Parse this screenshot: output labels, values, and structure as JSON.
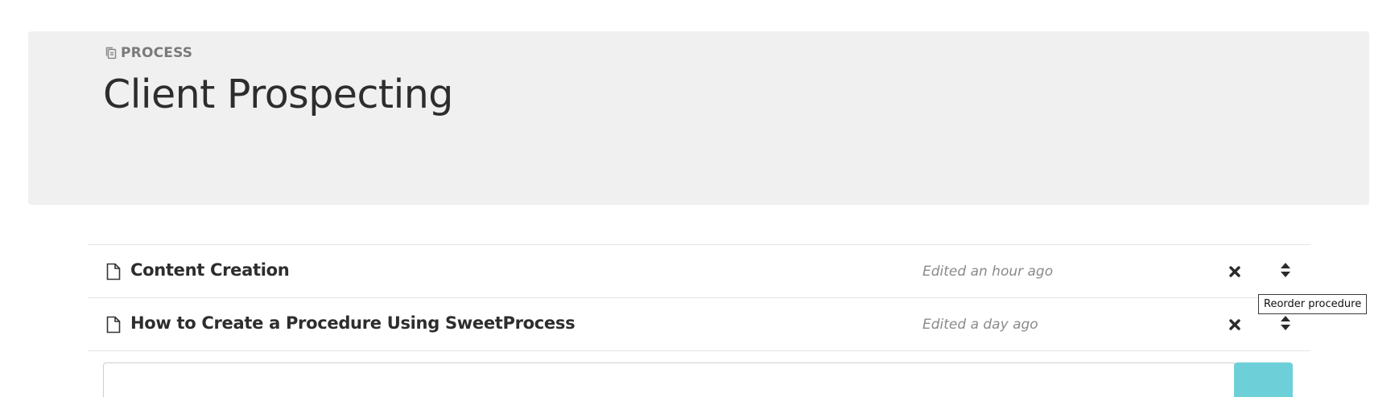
{
  "header": {
    "kicker_label": "PROCESS",
    "kicker_icon": "copy-icon",
    "title": "Client Prospecting"
  },
  "procedures": [
    {
      "title": "Content Creation",
      "edited": "Edited an hour ago",
      "icon": "document-icon"
    },
    {
      "title": "How to Create a Procedure Using SweetProcess",
      "edited": "Edited a day ago",
      "icon": "document-icon"
    }
  ],
  "tooltip": {
    "text": "Reorder procedure"
  },
  "colors": {
    "header_bg": "#f0f0f0",
    "accent": "#6dd0d8"
  }
}
